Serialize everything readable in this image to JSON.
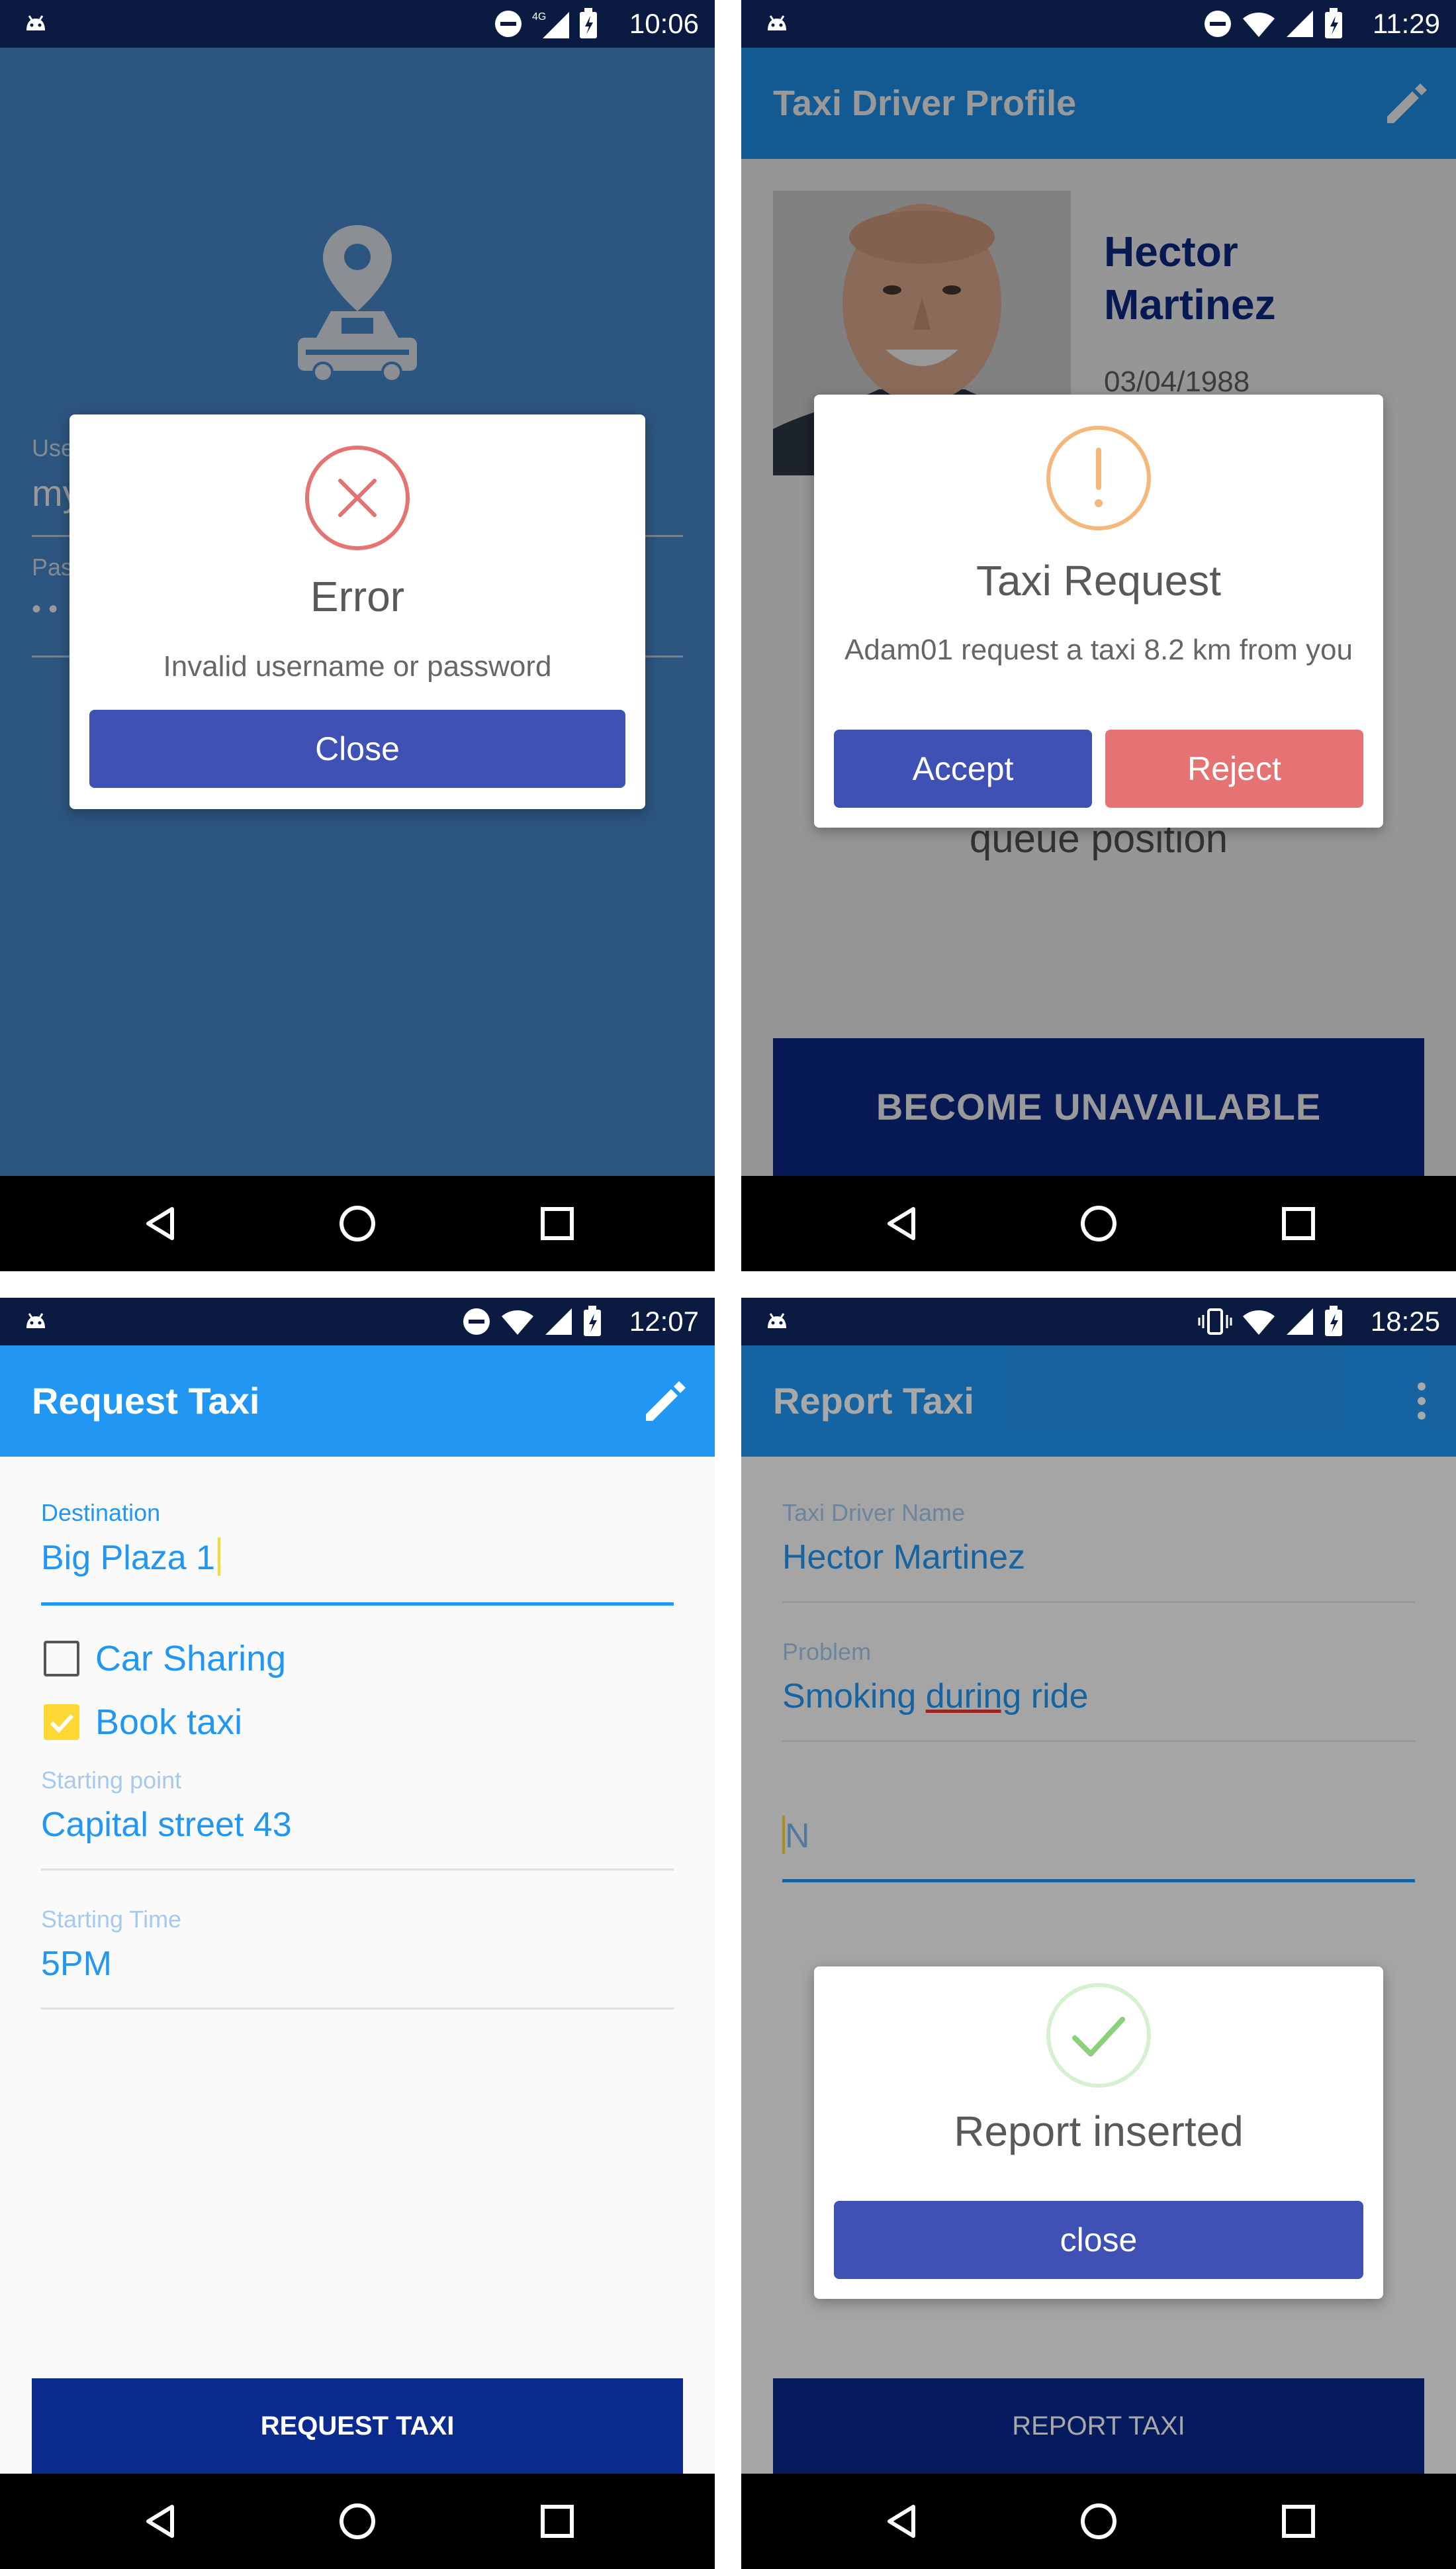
{
  "screens": {
    "login_error": {
      "status_time": "10:06",
      "field_username_label": "Use",
      "field_username_value": "my",
      "field_password_label": "Pas",
      "field_password_value": "• •",
      "dialog": {
        "title": "Error",
        "message": "Invalid username or password",
        "close_label": "Close"
      }
    },
    "driver_profile": {
      "status_time": "11:29",
      "app_title": "Taxi Driver Profile",
      "driver_name_line1": "Hector",
      "driver_name_line2": "Martinez",
      "birth_date": "03/04/1988",
      "queue_text": "queue position",
      "unavailable_label": "BECOME UNAVAILABLE",
      "dialog": {
        "title": "Taxi Request",
        "message": "Adam01 request a taxi 8.2 km from you",
        "accept_label": "Accept",
        "reject_label": "Reject"
      }
    },
    "request_taxi": {
      "status_time": "12:07",
      "app_title": "Request Taxi",
      "destination_label": "Destination",
      "destination_value": "Big Plaza 1",
      "car_sharing_label": "Car Sharing",
      "car_sharing_checked": false,
      "book_taxi_label": "Book taxi",
      "book_taxi_checked": true,
      "starting_point_label": "Starting point",
      "starting_point_value": "Capital street 43",
      "starting_time_label": "Starting Time",
      "starting_time_value": "5PM",
      "submit_label": "REQUEST TAXI"
    },
    "report_taxi": {
      "status_time": "18:25",
      "app_title": "Report Taxi",
      "driver_name_label": "Taxi Driver Name",
      "driver_name_value": "Hector Martinez",
      "problem_label": "Problem",
      "problem_value_pre": "Smoking ",
      "problem_value_mark": "during",
      "problem_value_post": " ride",
      "note_value": "N",
      "submit_label": "REPORT TAXI",
      "dialog": {
        "title": "Report inserted",
        "close_label": "close"
      }
    }
  },
  "colors": {
    "primary": "#2196f3",
    "dark_primary": "#0a2a8e",
    "dialog_button": "#3f51b5",
    "reject": "#e57373",
    "error": "#e57373",
    "warning": "#f6b77a",
    "success": "#8bd07a",
    "checkbox_checked": "#fdd835"
  },
  "icons": [
    "android-icon",
    "dnd-icon",
    "lte-icon",
    "signal-icon",
    "battery-icon",
    "wifi-icon",
    "vibrate-icon",
    "map-pin-taxi-icon",
    "error-x-icon",
    "warning-icon",
    "checkmark-icon",
    "edit-icon",
    "overflow-menu-icon",
    "back-icon",
    "home-icon",
    "recents-icon",
    "checkbox-icon"
  ]
}
